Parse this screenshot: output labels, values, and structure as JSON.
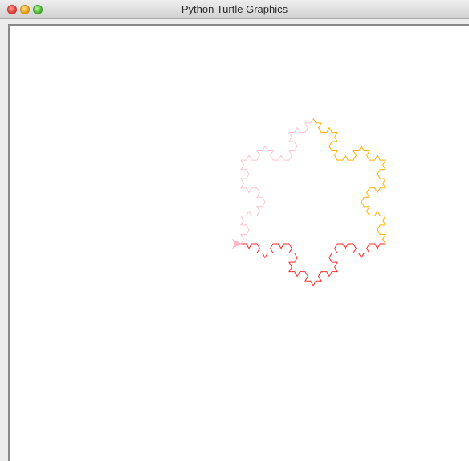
{
  "window": {
    "title": "Python Turtle Graphics",
    "controls": {
      "close_icon": "close-icon",
      "minimize_icon": "minimize-icon",
      "maximize_icon": "maximize-icon"
    }
  },
  "canvas": {
    "background": "#ffffff",
    "drawing": {
      "shape": "koch-snowflake",
      "depth": 3,
      "segment_colors": [
        "#ff2a2a",
        "#ffb000",
        "#ffc2cc"
      ],
      "turtle_color": "#ffb6c1",
      "turtle_icon": "turtle-arrow-icon"
    }
  }
}
